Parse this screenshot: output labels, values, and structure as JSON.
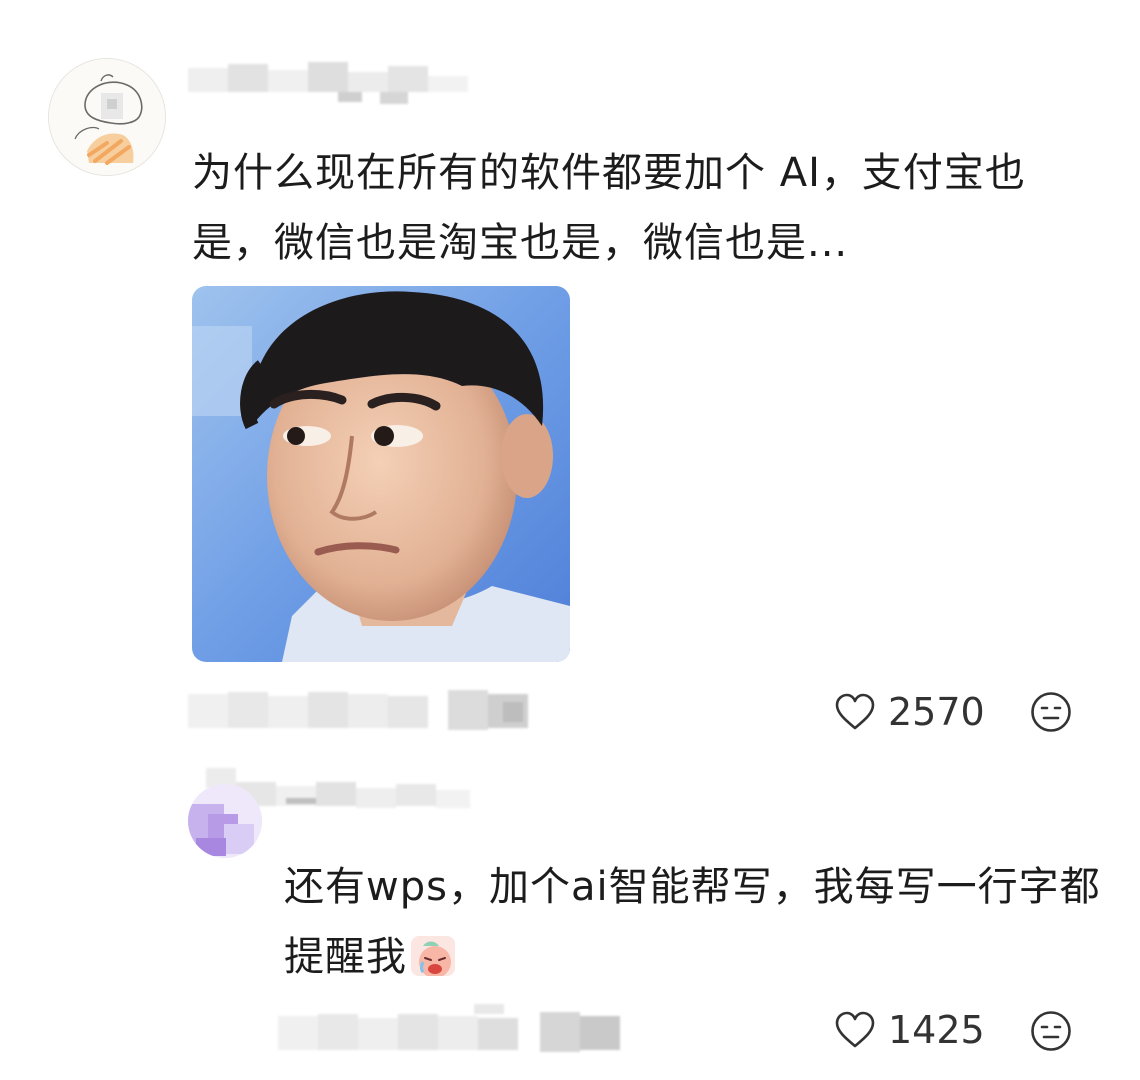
{
  "main_comment": {
    "username": "",
    "text": "为什么现在所有的软件都要加个 AI，支付宝也是，微信也是淘宝也是，微信也是...",
    "image_alt": "",
    "likes": "2570",
    "icons": {
      "like": "heart-icon",
      "react": "neutral-face-icon"
    }
  },
  "reply": {
    "username": "",
    "text": "还有wps，加个ai智能帮写，我每写一行字都提醒我",
    "sticker": "crying-sticker-icon",
    "likes": "1425",
    "icons": {
      "like": "heart-icon",
      "react": "neutral-face-icon"
    }
  },
  "colors": {
    "text": "#1c1c1c",
    "count": "#333333",
    "icon_stroke": "#333333",
    "pixelation_light": "#eeeeee",
    "pixelation_dark": "#c8c8c8",
    "reply_avatar": "#b79be6"
  }
}
